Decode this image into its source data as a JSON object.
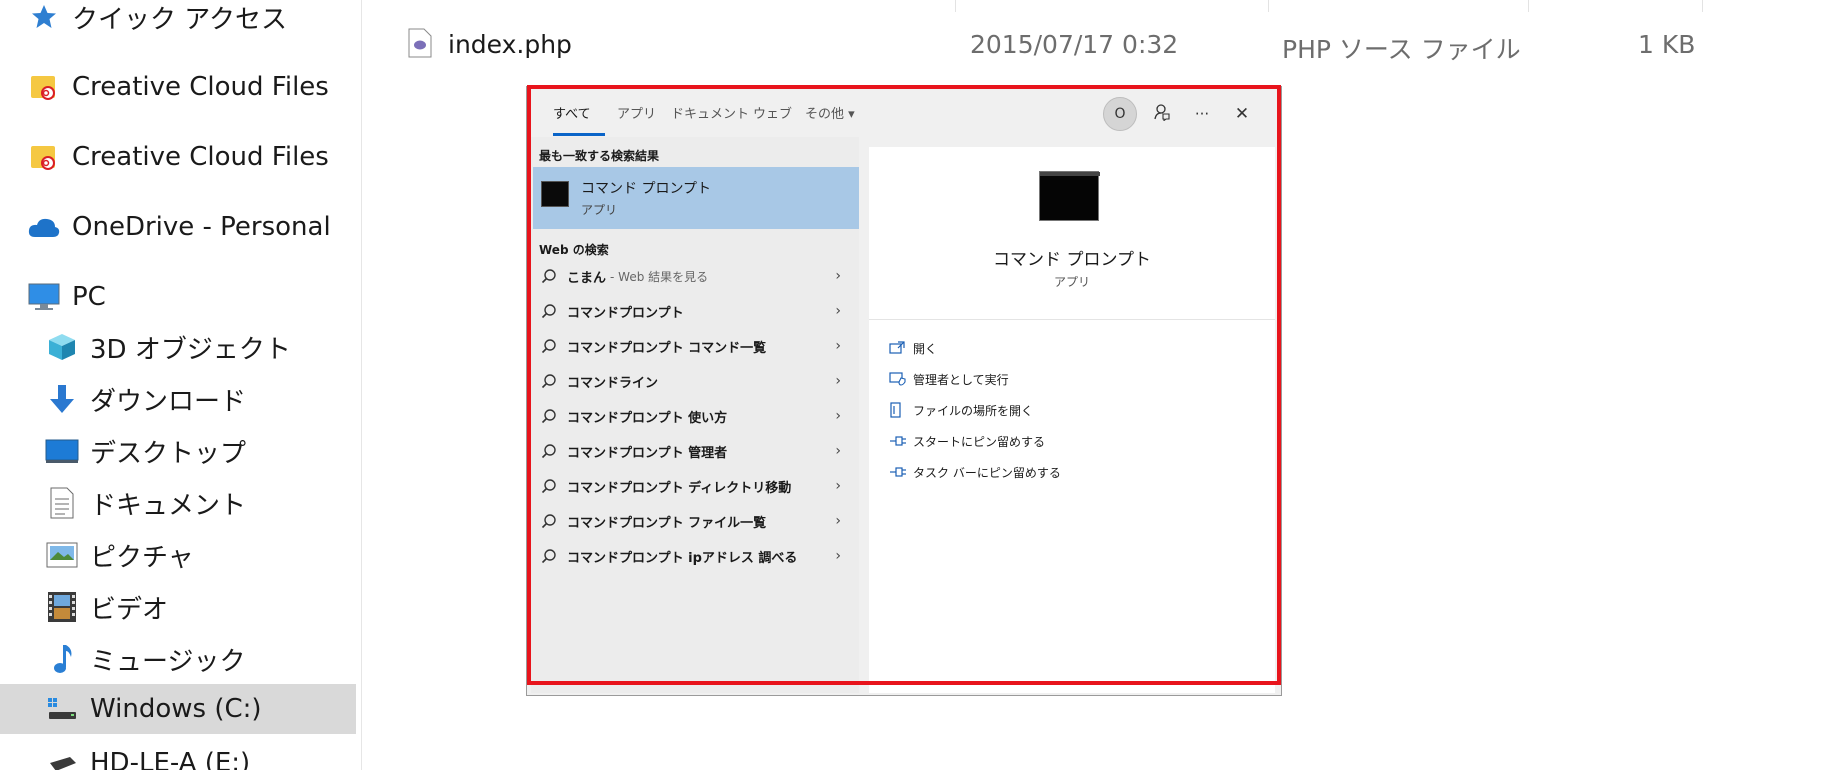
{
  "nav": {
    "items": [
      {
        "label": "クイック アクセス",
        "icon": "star-icon"
      },
      {
        "label": "Creative Cloud Files",
        "icon": "creative-cloud-folder-icon"
      },
      {
        "label": "Creative Cloud Files",
        "icon": "creative-cloud-folder-icon"
      },
      {
        "label": "OneDrive - Personal",
        "icon": "cloud-icon"
      },
      {
        "label": "PC",
        "icon": "monitor-icon"
      },
      {
        "label": "3D オブジェクト",
        "icon": "cube-icon"
      },
      {
        "label": "ダウンロード",
        "icon": "download-arrow-icon"
      },
      {
        "label": "デスクトップ",
        "icon": "desktop-icon"
      },
      {
        "label": "ドキュメント",
        "icon": "document-icon"
      },
      {
        "label": "ピクチャ",
        "icon": "picture-icon"
      },
      {
        "label": "ビデオ",
        "icon": "film-icon"
      },
      {
        "label": "ミュージック",
        "icon": "music-note-icon"
      },
      {
        "label": "Windows (C:)",
        "icon": "drive-icon"
      },
      {
        "label": "HD-LE-A (E:)",
        "icon": "external-drive-icon"
      }
    ]
  },
  "file": {
    "name": "index.php",
    "modified": "2015/07/17 0:32",
    "type": "PHP ソース ファイル",
    "size": "1 KB"
  },
  "search": {
    "tabs": [
      "すべて",
      "アプリ",
      "ドキュメント",
      "ウェブ",
      "その他"
    ],
    "more_caret": "▾",
    "avatar_letter": "O",
    "toolbar_more": "···",
    "close": "✕",
    "best_match_heading": "最も一致する検索結果",
    "best_match": {
      "title": "コマンド プロンプト",
      "subtitle": "アプリ"
    },
    "web_heading": "Web の検索",
    "web_results": [
      {
        "label": "こまん",
        "hint": "- Web 結果を見る"
      },
      {
        "label": "コマンドプロンプト",
        "hint": ""
      },
      {
        "label": "コマンドプロンプト コマンド一覧",
        "hint": ""
      },
      {
        "label": "コマンドライン",
        "hint": ""
      },
      {
        "label": "コマンドプロンプト 使い方",
        "hint": ""
      },
      {
        "label": "コマンドプロンプト 管理者",
        "hint": ""
      },
      {
        "label": "コマンドプロンプト ディレクトリ移動",
        "hint": ""
      },
      {
        "label": "コマンドプロンプト ファイル一覧",
        "hint": ""
      },
      {
        "label": "コマンドプロンプト ipアドレス 調べる",
        "hint": ""
      }
    ],
    "chevron": "›",
    "preview": {
      "title": "コマンド プロンプト",
      "subtitle": "アプリ"
    },
    "actions": [
      {
        "label": "開く",
        "icon": "open-icon"
      },
      {
        "label": "管理者として実行",
        "icon": "run-as-admin-icon"
      },
      {
        "label": "ファイルの場所を開く",
        "icon": "file-location-icon"
      },
      {
        "label": "スタートにピン留めする",
        "icon": "pin-icon"
      },
      {
        "label": "タスク バーにピン留めする",
        "icon": "pin-icon"
      }
    ]
  },
  "colors": {
    "highlight": "#a8c8e6",
    "frame": "#e8141c",
    "accent": "#0a64c8"
  }
}
